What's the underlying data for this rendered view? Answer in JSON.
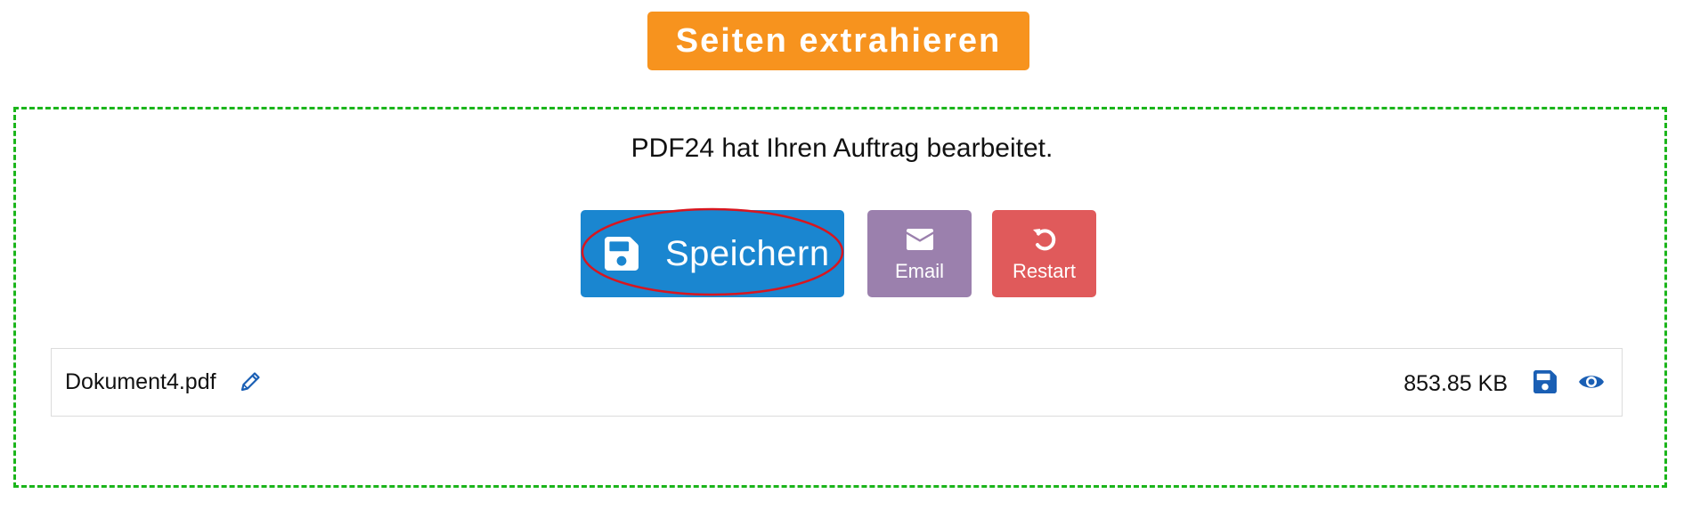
{
  "header": {
    "title": "Seiten extrahieren"
  },
  "result": {
    "status_text": "PDF24 hat Ihren Auftrag bearbeitet.",
    "actions": {
      "save_label": "Speichern",
      "email_label": "Email",
      "restart_label": "Restart"
    }
  },
  "file": {
    "name": "Dokument4.pdf",
    "size": "853.85 KB"
  },
  "icons": {
    "save": "floppy-disk-icon",
    "email": "envelope-icon",
    "restart": "undo-arrow-icon",
    "edit": "pencil-icon",
    "view": "eye-icon"
  },
  "colors": {
    "header_bg": "#f7931e",
    "save_bg": "#1a86d0",
    "email_bg": "#9b80ad",
    "restart_bg": "#e05a5b",
    "panel_border": "#1bb51b",
    "highlight": "#d8161f",
    "icon_blue": "#1a5fb4"
  }
}
